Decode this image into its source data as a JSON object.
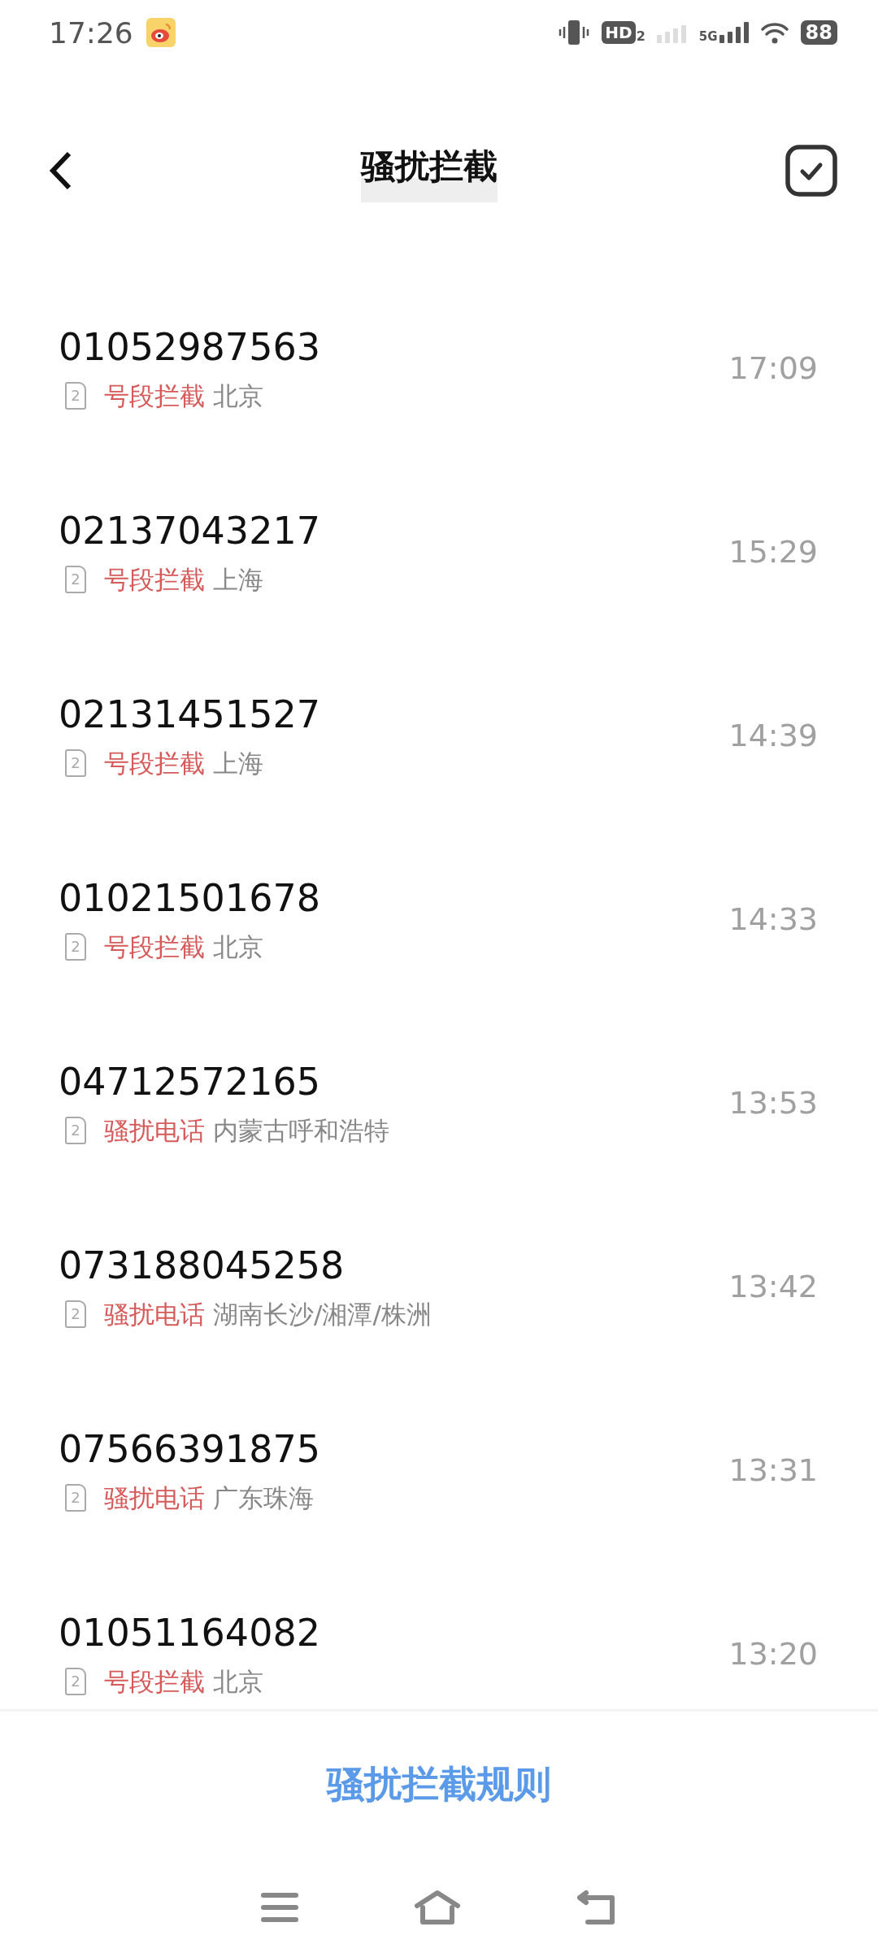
{
  "status_bar": {
    "time": "17:26",
    "hd_label": "HD",
    "hd_sub": "2",
    "network": "5G",
    "battery": "88"
  },
  "header": {
    "title": "骚扰拦截"
  },
  "calls": [
    {
      "number": "01052987563",
      "sim": "2",
      "tag": "号段拦截",
      "location": "北京",
      "time": "17:09"
    },
    {
      "number": "02137043217",
      "sim": "2",
      "tag": "号段拦截",
      "location": "上海",
      "time": "15:29"
    },
    {
      "number": "02131451527",
      "sim": "2",
      "tag": "号段拦截",
      "location": "上海",
      "time": "14:39"
    },
    {
      "number": "01021501678",
      "sim": "2",
      "tag": "号段拦截",
      "location": "北京",
      "time": "14:33"
    },
    {
      "number": "04712572165",
      "sim": "2",
      "tag": "骚扰电话",
      "location": "内蒙古呼和浩特",
      "time": "13:53"
    },
    {
      "number": "073188045258",
      "sim": "2",
      "tag": "骚扰电话",
      "location": "湖南长沙/湘潭/株洲",
      "time": "13:42"
    },
    {
      "number": "07566391875",
      "sim": "2",
      "tag": "骚扰电话",
      "location": "广东珠海",
      "time": "13:31"
    },
    {
      "number": "01051164082",
      "sim": "2",
      "tag": "号段拦截",
      "location": "北京",
      "time": "13:20"
    }
  ],
  "rules_button": "骚扰拦截规则"
}
